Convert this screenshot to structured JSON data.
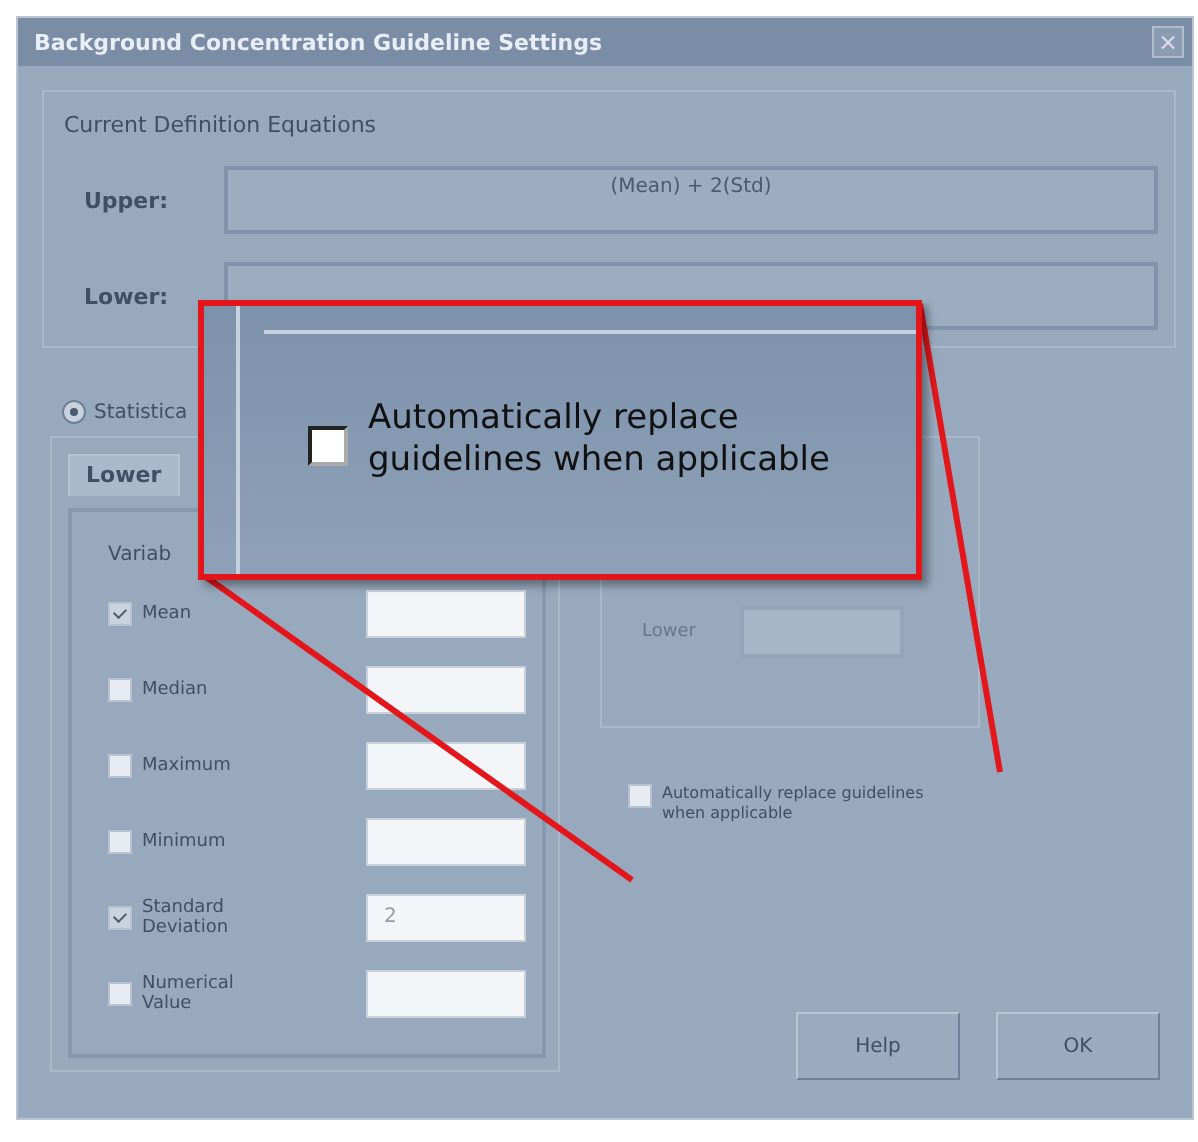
{
  "window": {
    "title": "Background Concentration Guideline Settings",
    "close": "×"
  },
  "equations": {
    "heading": "Current Definition Equations",
    "rows": [
      {
        "label": "Upper:",
        "value": "(Mean) + 2(Std)"
      },
      {
        "label": "Lower:"
      }
    ]
  },
  "mode_radio": {
    "label": "Statistica",
    "selected": true
  },
  "tabs": [
    {
      "label": "Lower",
      "selected": true
    }
  ],
  "variables": {
    "heading": "Variab",
    "rows": [
      {
        "label": "Mean",
        "checked": true
      },
      {
        "label": "Median",
        "checked": false
      },
      {
        "label": "Maximum",
        "checked": false
      },
      {
        "label": "Minimum",
        "checked": false
      },
      {
        "label": "Standard Deviation",
        "checked": true,
        "value": "2"
      },
      {
        "label": "Numerical Value",
        "checked": false
      }
    ]
  },
  "limit": {
    "label": "Lower",
    "disabled": true
  },
  "auto_replace": {
    "label": "Automatically replace guidelines when applicable",
    "checked": false
  },
  "buttons": [
    "Help",
    "OK"
  ],
  "callout": {
    "label": "Automatically replace guidelines when applicable",
    "checked": false
  }
}
